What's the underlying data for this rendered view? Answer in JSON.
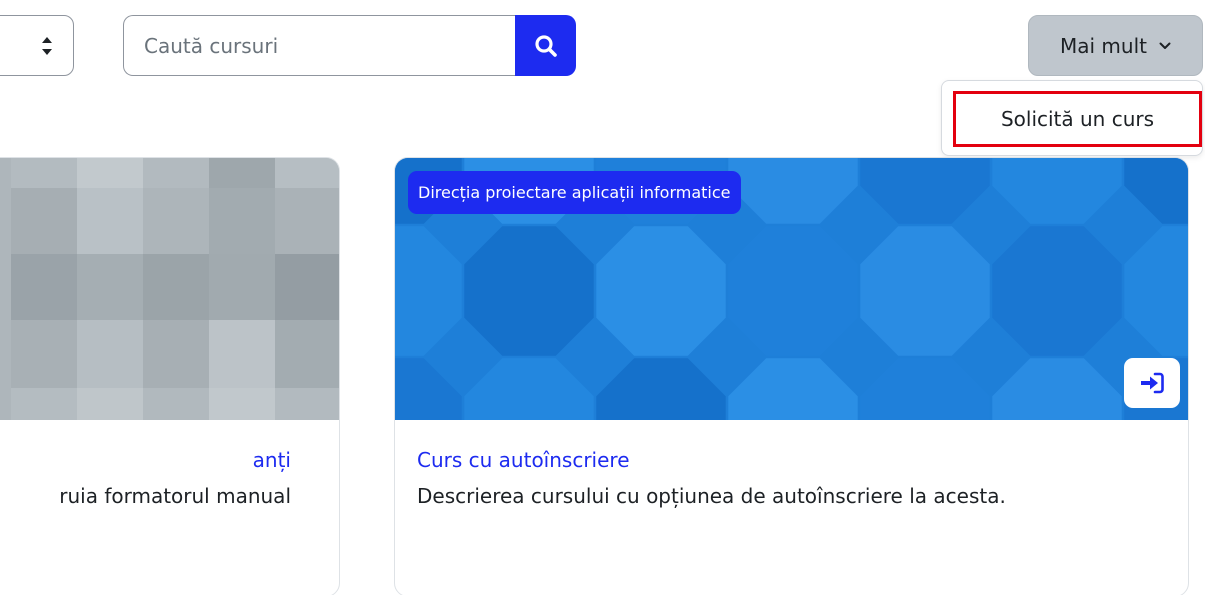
{
  "search": {
    "placeholder": "Caută cursuri",
    "value": ""
  },
  "more_menu": {
    "label": "Mai mult",
    "items": [
      {
        "label": "Solicită un curs"
      }
    ]
  },
  "courses": [
    {
      "title": "anți",
      "description": "ruia formatorul manual"
    },
    {
      "category": "Direcția proiectare aplicații informatice",
      "title": "Curs cu autoînscriere",
      "description": "Descrierea cursului cu opțiunea de autoînscriere la acesta.",
      "enrol_icon": "self-enrol-icon"
    }
  ],
  "colors": {
    "primary": "#1d2bf0",
    "highlight": "#e3000f",
    "secondary_button": "#bfc6cd"
  }
}
